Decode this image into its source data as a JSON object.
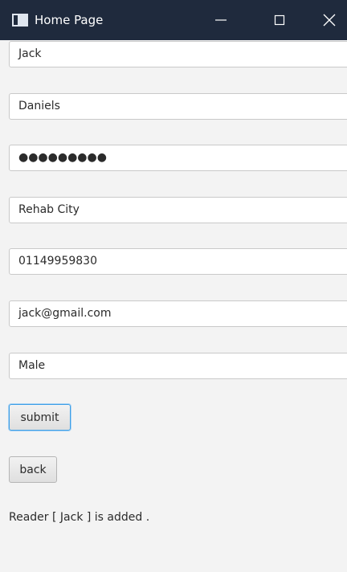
{
  "window": {
    "title": "Home Page"
  },
  "form": {
    "first_name": "Jack",
    "last_name": "Daniels",
    "password": "●●●●●●●●●",
    "address": "Rehab City",
    "phone": "01149959830",
    "email": "jack@gmail.com",
    "gender": "Male"
  },
  "buttons": {
    "submit_label": "submit",
    "back_label": "back"
  },
  "status": {
    "message": "Reader [ Jack ] is added ."
  },
  "colors": {
    "titlebar": "#1f2a3d",
    "focus_accent": "#3b9ee6"
  }
}
